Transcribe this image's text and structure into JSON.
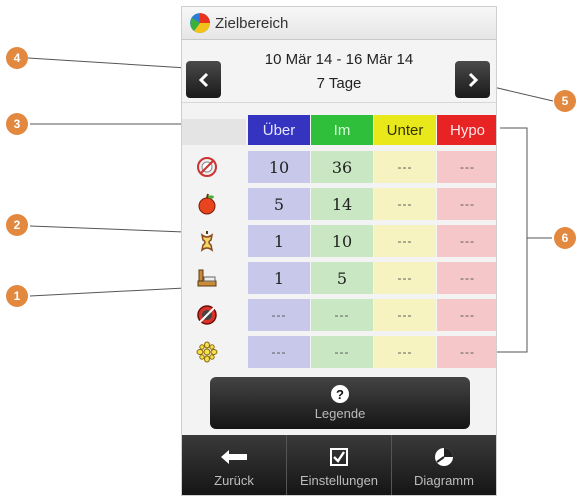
{
  "header": {
    "title": "Zielbereich"
  },
  "date_nav": {
    "range": "10 Mär 14 - 16 Mär 14",
    "days": "7 Tage"
  },
  "table": {
    "headers": [
      "Über",
      "Im",
      "Unter",
      "Hypo"
    ],
    "header_colors": [
      "#3434c0",
      "#2fbf3b",
      "#e8e81a",
      "#e82323"
    ],
    "header_text_colors": [
      "#e6e6ff",
      "#d9ffd9",
      "#333300",
      "#ffe6e6"
    ],
    "cell_colors": [
      "#c8c8ea",
      "#c9e7c3",
      "#f6f3c0",
      "#f5c7c9"
    ],
    "rows": [
      {
        "icon": "fasting-icon",
        "values": [
          "10",
          "36",
          "---",
          "---"
        ]
      },
      {
        "icon": "before-meal-icon",
        "values": [
          "5",
          "14",
          "---",
          "---"
        ]
      },
      {
        "icon": "after-meal-icon",
        "values": [
          "1",
          "10",
          "---",
          "---"
        ]
      },
      {
        "icon": "bedtime-icon",
        "values": [
          "1",
          "5",
          "---",
          "---"
        ]
      },
      {
        "icon": "no-marker-icon",
        "values": [
          "---",
          "---",
          "---",
          "---"
        ]
      },
      {
        "icon": "other-icon",
        "values": [
          "---",
          "---",
          "---",
          "---"
        ]
      }
    ]
  },
  "legend": {
    "label": "Legende"
  },
  "bottom_bar": {
    "back": "Zurück",
    "settings": "Einstellungen",
    "chart": "Diagramm"
  },
  "callouts": [
    "1",
    "2",
    "3",
    "4",
    "5",
    "6"
  ],
  "accent": "#e2883f"
}
